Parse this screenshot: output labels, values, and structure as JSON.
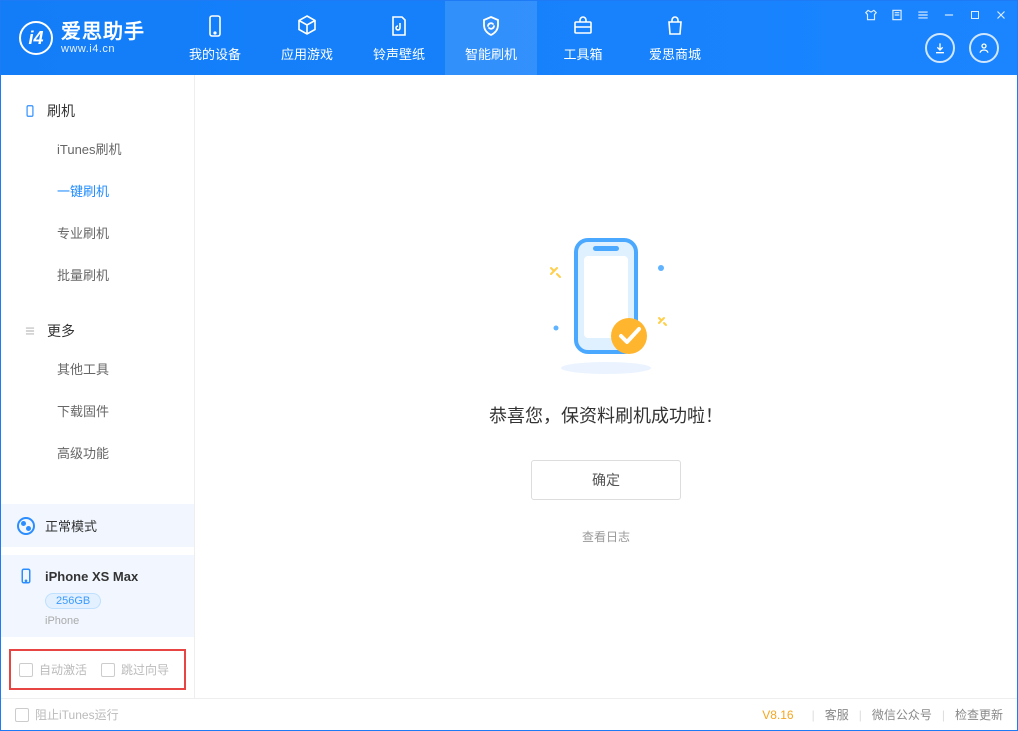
{
  "app": {
    "name": "爱思助手",
    "url": "www.i4.cn"
  },
  "tabs": [
    {
      "id": "device",
      "label": "我的设备"
    },
    {
      "id": "apps",
      "label": "应用游戏"
    },
    {
      "id": "ring",
      "label": "铃声壁纸"
    },
    {
      "id": "flash",
      "label": "智能刷机"
    },
    {
      "id": "tools",
      "label": "工具箱"
    },
    {
      "id": "store",
      "label": "爱思商城"
    }
  ],
  "sidebar": {
    "section1": {
      "title": "刷机",
      "items": [
        "iTunes刷机",
        "一键刷机",
        "专业刷机",
        "批量刷机"
      ],
      "active_index": 1
    },
    "section2": {
      "title": "更多",
      "items": [
        "其他工具",
        "下载固件",
        "高级功能"
      ]
    }
  },
  "mode": {
    "label": "正常模式"
  },
  "device": {
    "name": "iPhone XS Max",
    "capacity": "256GB",
    "type": "iPhone"
  },
  "options": {
    "auto_activate": "自动激活",
    "skip_guide": "跳过向导"
  },
  "main": {
    "success_msg": "恭喜您，保资料刷机成功啦！",
    "ok_label": "确定",
    "view_log_label": "查看日志"
  },
  "footer": {
    "block_itunes": "阻止iTunes运行",
    "version": "V8.16",
    "links": [
      "客服",
      "微信公众号",
      "检查更新"
    ]
  }
}
